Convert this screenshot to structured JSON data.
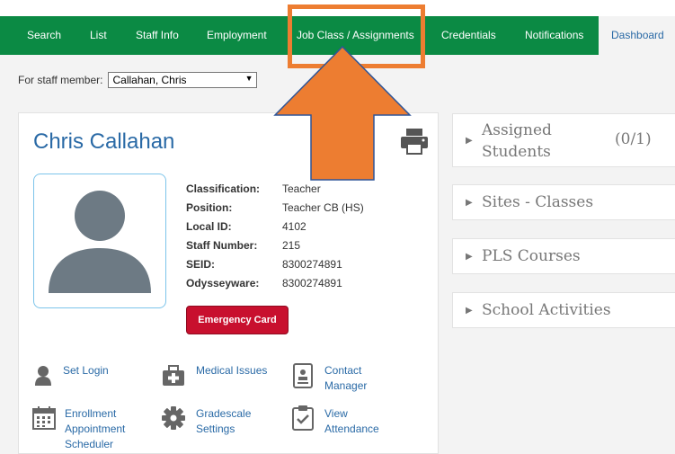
{
  "nav": {
    "items": [
      {
        "label": "Search"
      },
      {
        "label": "List"
      },
      {
        "label": "Staff Info"
      },
      {
        "label": "Employment"
      },
      {
        "label": "Job Class / Assignments"
      },
      {
        "label": "Credentials"
      },
      {
        "label": "Notifications"
      },
      {
        "label": "Dashboard"
      }
    ],
    "active": "Dashboard"
  },
  "staff_selector": {
    "label": "For staff member:",
    "value": "Callahan, Chris"
  },
  "profile": {
    "name": "Chris Callahan",
    "details": [
      {
        "label": "Classification:",
        "value": "Teacher"
      },
      {
        "label": "Position:",
        "value": "Teacher CB (HS)"
      },
      {
        "label": "Local ID:",
        "value": "4102"
      },
      {
        "label": "Staff Number:",
        "value": "215"
      },
      {
        "label": "SEID:",
        "value": "8300274891"
      },
      {
        "label": "Odysseyware:",
        "value": "8300274891"
      }
    ],
    "emergency_card": "Emergency Card"
  },
  "links": {
    "set_login": "Set Login",
    "medical_issues": "Medical Issues",
    "contact_line1": "Contact",
    "contact_line2": "Manager",
    "enroll_line1": "Enrollment",
    "enroll_line2": "Appointment",
    "enroll_line3": "Scheduler",
    "grade_line1": "Gradescale",
    "grade_line2": "Settings",
    "view_line1": "View",
    "view_line2": "Attendance"
  },
  "panels": {
    "assigned_line1": "Assigned",
    "assigned_line2": "Students",
    "assigned_count": "(0/1)",
    "sites": "Sites - Classes",
    "pls": "PLS Courses",
    "activities": "School Activities"
  },
  "colors": {
    "nav": "#0b8a44",
    "link": "#2a6aa6",
    "emergency": "#c8102e",
    "annotation": "#ed7d31"
  }
}
